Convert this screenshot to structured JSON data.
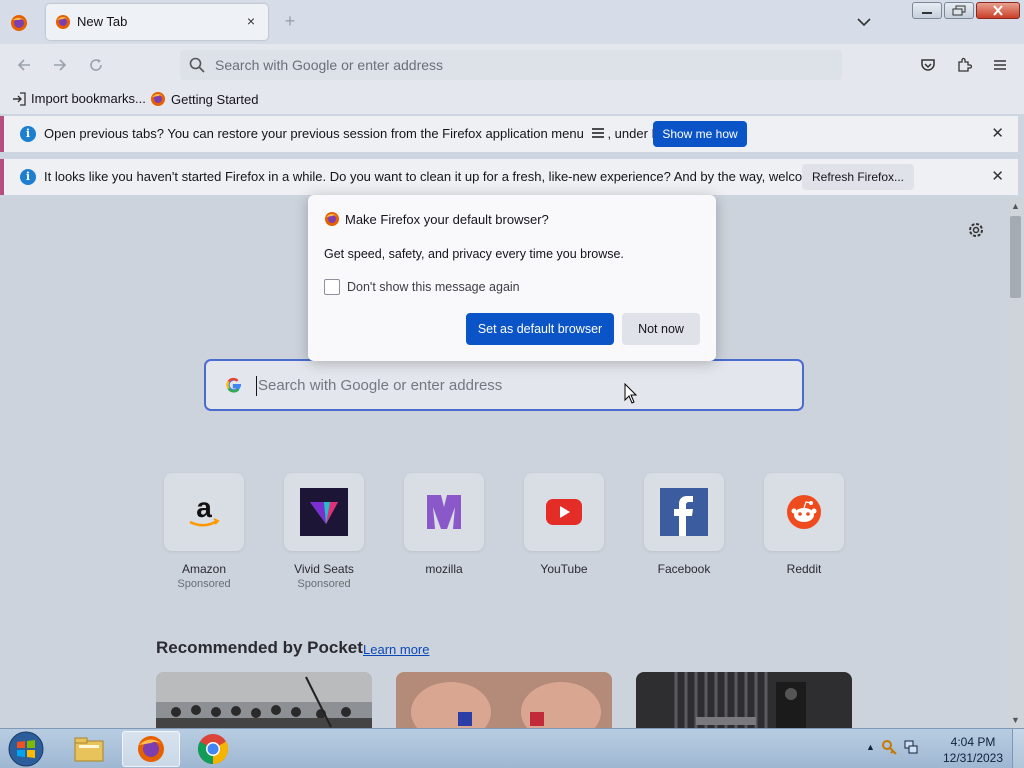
{
  "browser": {
    "tab": {
      "title": "New Tab",
      "close": "×"
    },
    "new_tab": "+",
    "url_placeholder": "Search with Google or enter address"
  },
  "bookmarks": [
    {
      "label": "Import bookmarks...",
      "icon": "import-icon"
    },
    {
      "label": "Getting Started",
      "icon": "firefox-icon"
    }
  ],
  "notifications": [
    {
      "message_a": "Open previous tabs? You can restore your previous session from the Firefox application menu",
      "message_b": ", under History.",
      "button": "Show me how"
    },
    {
      "message": "It looks like you haven't started Firefox in a while. Do you want to clean it up for a fresh, like-new experience? And by the way, welcome back!",
      "button": "Refresh Firefox..."
    }
  ],
  "modal": {
    "title": "Make Firefox your default browser?",
    "body": "Get speed, safety, and privacy every time you browse.",
    "checkbox_label": "Don't show this message again",
    "primary_button": "Set as default browser",
    "secondary_button": "Not now"
  },
  "newtab": {
    "search_placeholder": "Search with Google or enter address",
    "shortcuts": [
      {
        "name": "Amazon",
        "sponsored": "Sponsored"
      },
      {
        "name": "Vivid Seats",
        "sponsored": "Sponsored"
      },
      {
        "name": "mozilla",
        "sponsored": ""
      },
      {
        "name": "YouTube",
        "sponsored": ""
      },
      {
        "name": "Facebook",
        "sponsored": ""
      },
      {
        "name": "Reddit",
        "sponsored": ""
      }
    ],
    "pocket_heading": "Recommended by Pocket",
    "pocket_link": "Learn more"
  },
  "taskbar": {
    "time": "4:04 PM",
    "date": "12/31/2023"
  },
  "colors": {
    "accent": "#0b54c8",
    "notification_stripe": "#b64f7e",
    "info_icon": "#1e7fd0"
  }
}
